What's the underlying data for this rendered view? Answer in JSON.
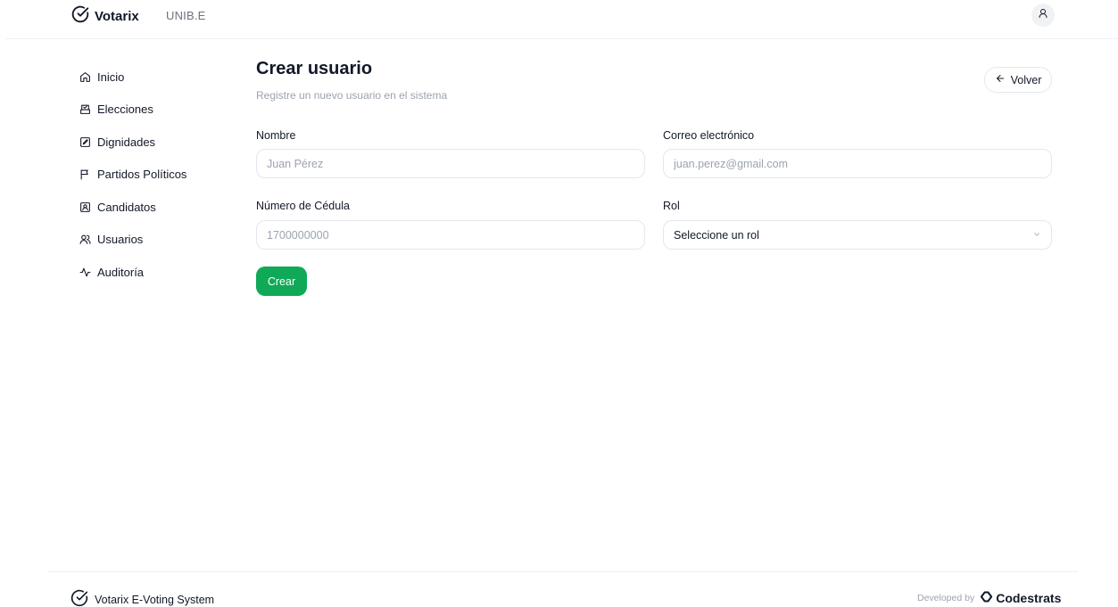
{
  "header": {
    "brand": "Votarix",
    "brand_icon": "check-circle-icon",
    "organization": "UNIB.E",
    "user_icon": "user-icon"
  },
  "sidebar": {
    "items": [
      {
        "label": "Inicio",
        "icon": "home-icon"
      },
      {
        "label": "Elecciones",
        "icon": "ballot-box-icon"
      },
      {
        "label": "Dignidades",
        "icon": "square-pen-icon"
      },
      {
        "label": "Partidos Políticos",
        "icon": "flag-icon"
      },
      {
        "label": "Candidatos",
        "icon": "id-badge-icon"
      },
      {
        "label": "Usuarios",
        "icon": "users-icon"
      },
      {
        "label": "Auditoría",
        "icon": "activity-icon"
      }
    ]
  },
  "page": {
    "title": "Crear usuario",
    "subtitle": "Registre un nuevo usuario en el sistema",
    "back_label": "Volver"
  },
  "form": {
    "nombre": {
      "label": "Nombre",
      "placeholder": "Juan Pérez",
      "value": ""
    },
    "correo": {
      "label": "Correo electrónico",
      "placeholder": "juan.perez@gmail.com",
      "value": ""
    },
    "cedula": {
      "label": "Número de Cédula",
      "placeholder": "1700000000",
      "value": ""
    },
    "rol": {
      "label": "Rol",
      "selected": "Seleccione un rol"
    },
    "submit_label": "Crear"
  },
  "footer": {
    "system_name": "Votarix E-Voting System",
    "developed_by": "Developed by",
    "company": "Codestrats"
  },
  "colors": {
    "primary": "#10a957",
    "text": "#111827",
    "muted": "#9ca3af",
    "border": "#e5e7eb"
  }
}
